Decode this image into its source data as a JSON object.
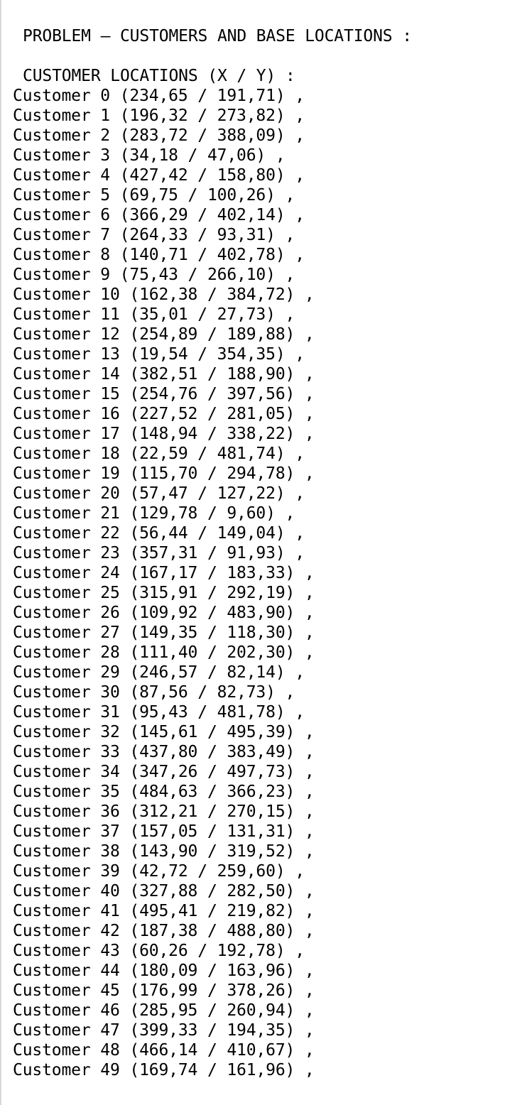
{
  "problem_header": "PROBLEM – CUSTOMERS AND BASE LOCATIONS :",
  "locations_header": "CUSTOMER LOCATIONS (X / Y) :",
  "customers": [
    "Customer 0 (234,65 / 191,71) ,",
    "Customer 1 (196,32 / 273,82) ,",
    "Customer 2 (283,72 / 388,09) ,",
    "Customer 3 (34,18 / 47,06) ,",
    "Customer 4 (427,42 / 158,80) ,",
    "Customer 5 (69,75 / 100,26) ,",
    "Customer 6 (366,29 / 402,14) ,",
    "Customer 7 (264,33 / 93,31) ,",
    "Customer 8 (140,71 / 402,78) ,",
    "Customer 9 (75,43 / 266,10) ,",
    "Customer 10 (162,38 / 384,72) ,",
    "Customer 11 (35,01 / 27,73) ,",
    "Customer 12 (254,89 / 189,88) ,",
    "Customer 13 (19,54 / 354,35) ,",
    "Customer 14 (382,51 / 188,90) ,",
    "Customer 15 (254,76 / 397,56) ,",
    "Customer 16 (227,52 / 281,05) ,",
    "Customer 17 (148,94 / 338,22) ,",
    "Customer 18 (22,59 / 481,74) ,",
    "Customer 19 (115,70 / 294,78) ,",
    "Customer 20 (57,47 / 127,22) ,",
    "Customer 21 (129,78 / 9,60) ,",
    "Customer 22 (56,44 / 149,04) ,",
    "Customer 23 (357,31 / 91,93) ,",
    "Customer 24 (167,17 / 183,33) ,",
    "Customer 25 (315,91 / 292,19) ,",
    "Customer 26 (109,92 / 483,90) ,",
    "Customer 27 (149,35 / 118,30) ,",
    "Customer 28 (111,40 / 202,30) ,",
    "Customer 29 (246,57 / 82,14) ,",
    "Customer 30 (87,56 / 82,73) ,",
    "Customer 31 (95,43 / 481,78) ,",
    "Customer 32 (145,61 / 495,39) ,",
    "Customer 33 (437,80 / 383,49) ,",
    "Customer 34 (347,26 / 497,73) ,",
    "Customer 35 (484,63 / 366,23) ,",
    "Customer 36 (312,21 / 270,15) ,",
    "Customer 37 (157,05 / 131,31) ,",
    "Customer 38 (143,90 / 319,52) ,",
    "Customer 39 (42,72 / 259,60) ,",
    "Customer 40 (327,88 / 282,50) ,",
    "Customer 41 (495,41 / 219,82) ,",
    "Customer 42 (187,38 / 488,80) ,",
    "Customer 43 (60,26 / 192,78) ,",
    "Customer 44 (180,09 / 163,96) ,",
    "Customer 45 (176,99 / 378,26) ,",
    "Customer 46 (285,95 / 260,94) ,",
    "Customer 47 (399,33 / 194,35) ,",
    "Customer 48 (466,14 / 410,67) ,",
    "Customer 49 (169,74 / 161,96) ,"
  ]
}
